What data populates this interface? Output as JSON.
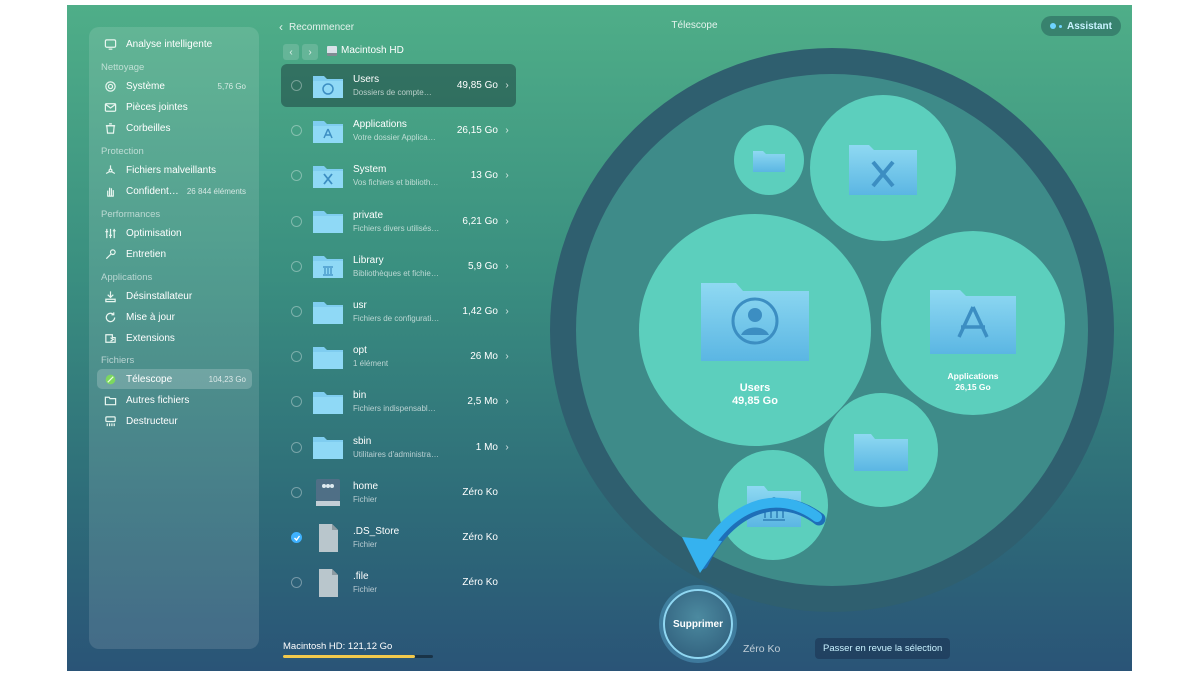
{
  "window": {
    "title": "Télescope",
    "back_label": "Recommencer",
    "assistant_label": "Assistant"
  },
  "sidebar": {
    "top_item": {
      "label": "Analyse intelligente",
      "icon": "monitor-icon"
    },
    "sections": [
      {
        "title": "Nettoyage",
        "items": [
          {
            "label": "Système",
            "value": "5,76 Go",
            "icon": "gear-icon"
          },
          {
            "label": "Pièces jointes",
            "value": "",
            "icon": "mail-icon"
          },
          {
            "label": "Corbeilles",
            "value": "",
            "icon": "trash-icon"
          }
        ]
      },
      {
        "title": "Protection",
        "items": [
          {
            "label": "Fichiers malveillants",
            "value": "",
            "icon": "biohazard-icon"
          },
          {
            "label": "Confident…",
            "value": "26 844 éléments",
            "icon": "hand-icon"
          }
        ]
      },
      {
        "title": "Performances",
        "items": [
          {
            "label": "Optimisation",
            "value": "",
            "icon": "sliders-icon"
          },
          {
            "label": "Entretien",
            "value": "",
            "icon": "wrench-icon"
          }
        ]
      },
      {
        "title": "Applications",
        "items": [
          {
            "label": "Désinstallateur",
            "value": "",
            "icon": "uninstall-icon"
          },
          {
            "label": "Mise à jour",
            "value": "",
            "icon": "update-icon"
          },
          {
            "label": "Extensions",
            "value": "",
            "icon": "extensions-icon"
          }
        ]
      },
      {
        "title": "Fichiers",
        "items": [
          {
            "label": "Télescope",
            "value": "104,23 Go",
            "icon": "telescope-icon",
            "active": true
          },
          {
            "label": "Autres fichiers",
            "value": "",
            "icon": "folder-icon"
          },
          {
            "label": "Destructeur",
            "value": "",
            "icon": "shredder-icon"
          }
        ]
      }
    ]
  },
  "path": {
    "drive": "Macintosh HD"
  },
  "files": [
    {
      "name": "Users",
      "desc": "Dossiers de compte…",
      "size": "49,85 Go",
      "chevron": true,
      "icon": "users-folder-icon",
      "selected": true,
      "checked": false
    },
    {
      "name": "Applications",
      "desc": "Votre dossier Applica…",
      "size": "26,15 Go",
      "chevron": true,
      "icon": "apps-folder-icon",
      "selected": false,
      "checked": false
    },
    {
      "name": "System",
      "desc": "Vos fichiers et bibliothèq…",
      "size": "13 Go",
      "chevron": true,
      "icon": "system-folder-icon",
      "selected": false,
      "checked": false
    },
    {
      "name": "private",
      "desc": "Fichiers divers utilisés…",
      "size": "6,21 Go",
      "chevron": true,
      "icon": "folder-icon",
      "selected": false,
      "checked": false
    },
    {
      "name": "Library",
      "desc": "Bibliothèques et fichier…",
      "size": "5,9 Go",
      "chevron": true,
      "icon": "library-folder-icon",
      "selected": false,
      "checked": false
    },
    {
      "name": "usr",
      "desc": "Fichiers de configurati…",
      "size": "1,42 Go",
      "chevron": true,
      "icon": "folder-icon",
      "selected": false,
      "checked": false
    },
    {
      "name": "opt",
      "desc": "1 élément",
      "size": "26 Mo",
      "chevron": true,
      "icon": "folder-icon",
      "selected": false,
      "checked": false
    },
    {
      "name": "bin",
      "desc": "Fichiers indispensables…",
      "size": "2,5 Mo",
      "chevron": true,
      "icon": "folder-icon",
      "selected": false,
      "checked": false
    },
    {
      "name": "sbin",
      "desc": "Utilitaires d'administratio…",
      "size": "1 Mo",
      "chevron": true,
      "icon": "folder-icon",
      "selected": false,
      "checked": false
    },
    {
      "name": "home",
      "desc": "Fichier",
      "size": "Zéro Ko",
      "chevron": false,
      "icon": "server-icon",
      "selected": false,
      "checked": false
    },
    {
      "name": ".DS_Store",
      "desc": "Fichier",
      "size": "Zéro Ko",
      "chevron": false,
      "icon": "file-icon",
      "selected": false,
      "checked": true
    },
    {
      "name": ".file",
      "desc": "Fichier",
      "size": "Zéro Ko",
      "chevron": false,
      "icon": "file-icon",
      "selected": false,
      "checked": false
    }
  ],
  "disk": {
    "label": "Macintosh HD: 121,12 Go",
    "used_fraction": 0.88
  },
  "bubbles": {
    "users": {
      "name": "Users",
      "size": "49,85 Go"
    },
    "applications": {
      "name": "Applications",
      "size": "26,15 Go"
    }
  },
  "actions": {
    "delete_label": "Supprimer",
    "selection_size": "Zéro Ko",
    "review_label": "Passer en revue la sélection"
  },
  "colors": {
    "accent": "#3fb2ff",
    "bubble": "#5ccfbd",
    "disk_fill": "#f2c94c"
  }
}
